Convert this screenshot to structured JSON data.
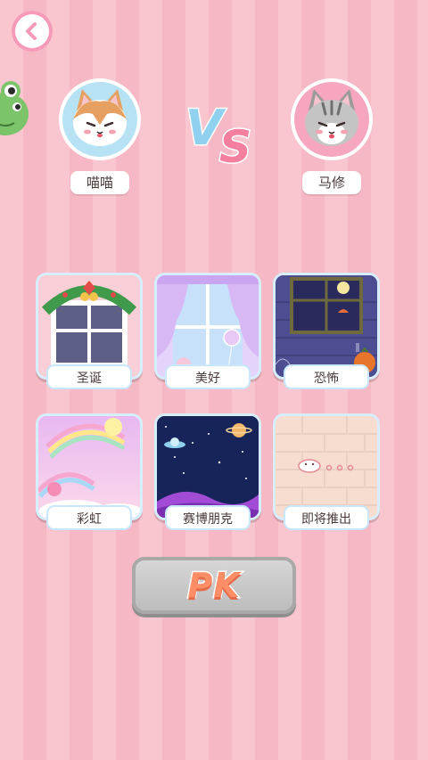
{
  "players": {
    "left": {
      "name": "喵喵"
    },
    "right": {
      "name": "马修"
    }
  },
  "vs_label": "VS",
  "themes": [
    {
      "label": "圣诞",
      "icon": "christmas-window"
    },
    {
      "label": "美好",
      "icon": "curtain-window"
    },
    {
      "label": "恐怖",
      "icon": "haunted-window"
    },
    {
      "label": "彩虹",
      "icon": "rainbow-scene"
    },
    {
      "label": "赛博朋克",
      "icon": "space-scene"
    },
    {
      "label": "即将推出",
      "icon": "coming-soon-wall"
    }
  ],
  "pk_button": {
    "label": "PK"
  },
  "colors": {
    "accent": "#f59ab8",
    "pk_text": "#ff8d66",
    "button_disabled": "#c8c8c8"
  }
}
